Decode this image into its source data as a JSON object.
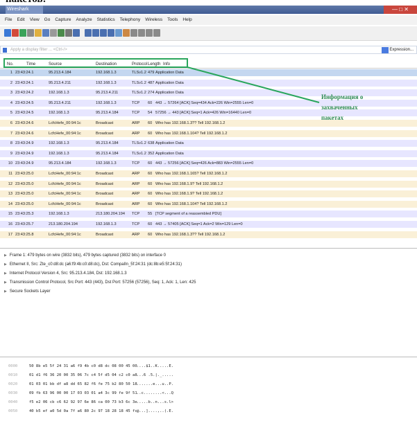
{
  "page": {
    "caption_fragment": "пакетов:"
  },
  "window": {
    "title": "Wireshark",
    "controls_label": "— □ ✕"
  },
  "menubar": [
    "File",
    "Edit",
    "View",
    "Go",
    "Capture",
    "Analyze",
    "Statistics",
    "Telephony",
    "Wireless",
    "Tools",
    "Help"
  ],
  "toolbar": {
    "icons": [
      "shark-fin-icon",
      "stop-icon",
      "restart-icon",
      "settings-icon",
      "open-file-icon",
      "save-icon",
      "close-file-icon",
      "reload-icon",
      "find-icon",
      "back-icon",
      "forward-icon",
      "go-to-icon",
      "first-icon",
      "last-icon",
      "autoscroll-icon",
      "colorize-icon",
      "zoom-in-icon",
      "zoom-out-icon",
      "zoom-reset-icon",
      "resize-columns-icon"
    ]
  },
  "filter": {
    "placeholder": "Apply a display filter ... <Ctrl-/>",
    "expression_label": "Expression..."
  },
  "columns": [
    "No.",
    "Time",
    "Source",
    "Destination",
    "Protocol",
    "Length",
    "Info"
  ],
  "packets": [
    {
      "no": "1",
      "time": "23:43:24.1",
      "src": "95.213.4.184",
      "dst": "192.168.1.3",
      "proto": "TLSv1.2",
      "len": "479",
      "info": "Application Data",
      "type": "sel"
    },
    {
      "no": "2",
      "time": "23:43:24.1",
      "src": "95.213.4.211",
      "dst": "192.168.1.3",
      "proto": "TLSv1.2",
      "len": "487",
      "info": "Application Data",
      "type": "tcp"
    },
    {
      "no": "3",
      "time": "23:43:24.2",
      "src": "192.168.1.3",
      "dst": "95.213.4.211",
      "proto": "TLSv1.2",
      "len": "274",
      "info": "Application Data",
      "type": "tcp"
    },
    {
      "no": "4",
      "time": "23:43:24.5",
      "src": "95.213.4.211",
      "dst": "192.168.1.3",
      "proto": "TCP",
      "len": "60",
      "info": "443 → 57264 [ACK] Seq=434 Ack=226 Win=2555 Len=0",
      "type": "tcp"
    },
    {
      "no": "5",
      "time": "23:43:24.5",
      "src": "192.168.1.3",
      "dst": "95.213.4.184",
      "proto": "TCP",
      "len": "54",
      "info": "57256 → 443 [ACK] Seq=1 Ack=426 Win=16440 Len=0",
      "type": "tcp"
    },
    {
      "no": "6",
      "time": "23:43:24.6",
      "src": "LcfcHefe_00:94:1c",
      "dst": "Broadcast",
      "proto": "ARP",
      "len": "60",
      "info": "Who has 192.168.1.3?? Tell 192.168.1.2",
      "type": "arp"
    },
    {
      "no": "7",
      "time": "23:43:24.6",
      "src": "LcfcHefe_00:94:1c",
      "dst": "Broadcast",
      "proto": "ARP",
      "len": "60",
      "info": "Who has 192.168.1.104? Tell 192.168.1.2",
      "type": "arp"
    },
    {
      "no": "8",
      "time": "23:43:24.9",
      "src": "192.168.1.3",
      "dst": "95.213.4.184",
      "proto": "TLSv1.2",
      "len": "638",
      "info": "Application Data",
      "type": "tcp"
    },
    {
      "no": "9",
      "time": "23:43:24.9",
      "src": "192.168.1.3",
      "dst": "95.213.4.184",
      "proto": "TLSv1.2",
      "len": "352",
      "info": "Application Data",
      "type": "tcp"
    },
    {
      "no": "10",
      "time": "23:43:24.9",
      "src": "95.213.4.184",
      "dst": "192.168.1.3",
      "proto": "TCP",
      "len": "60",
      "info": "443 → 57256 [ACK] Seq=426 Ack=883 Win=2555 Len=0",
      "type": "tcp"
    },
    {
      "no": "11",
      "time": "23:43:25.0",
      "src": "LcfcHefe_00:94:1c",
      "dst": "Broadcast",
      "proto": "ARP",
      "len": "60",
      "info": "Who has 192.168.1.165? Tell 192.168.1.2",
      "type": "arp"
    },
    {
      "no": "12",
      "time": "23:43:25.0",
      "src": "LcfcHefe_00:94:1c",
      "dst": "Broadcast",
      "proto": "ARP",
      "len": "60",
      "info": "Who has 192.168.1.9? Tell 192.168.1.2",
      "type": "arp"
    },
    {
      "no": "13",
      "time": "23:43:25.0",
      "src": "LcfcHefe_00:94:1c",
      "dst": "Broadcast",
      "proto": "ARP",
      "len": "60",
      "info": "Who has 192.168.1.9? Tell 192.168.1.2",
      "type": "arp"
    },
    {
      "no": "14",
      "time": "23:43:25.0",
      "src": "LcfcHefe_00:94:1c",
      "dst": "Broadcast",
      "proto": "ARP",
      "len": "60",
      "info": "Who has 192.168.1.104? Tell 192.168.1.2",
      "type": "arp"
    },
    {
      "no": "15",
      "time": "23:43:25.3",
      "src": "192.168.1.3",
      "dst": "213.180.204.194",
      "proto": "TCP",
      "len": "55",
      "info": "[TCP segment of a reassembled PDU]",
      "type": "tcp"
    },
    {
      "no": "16",
      "time": "23:43:25.7",
      "src": "213.180.204.194",
      "dst": "192.168.1.3",
      "proto": "TCP",
      "len": "60",
      "info": "443 → 57405 [ACK] Seq=1 Ack=2 Win=129 Len=0",
      "type": "tcp"
    },
    {
      "no": "17",
      "time": "23:43:25.8",
      "src": "LcfcHefe_00:94:1c",
      "dst": "Broadcast",
      "proto": "ARP",
      "len": "60",
      "info": "Who has 192.168.1.3?? Tell 192.168.1.2",
      "type": "arp"
    }
  ],
  "details": [
    "Frame 1: 479 bytes on wire (3832 bits), 479 bytes captured (3832 bits) on interface 0",
    "Ethernet II, Src: Zte_c0:d8:dc (a6:f9:4b:c0:d8:dc), Dst: CompalIn_5f:24:31 (dc:8b:e5:5f:24:31)",
    "Internet Protocol Version 4, Src: 95.213.4.184, Dst: 192.168.1.3",
    "Transmission Control Protocol, Src Port: 443 (443), Dst Port: 57256 (57256), Seq: 1, Ack: 1, Len: 425",
    "Secure Sockets Layer"
  ],
  "bytes": [
    {
      "off": "0000",
      "hex": "50 8b e5 5f 24 31 a6 f9  4b c0 d8 dc 08 00 45 00",
      "ascii": "....$1..K.....E."
    },
    {
      "off": "0010",
      "hex": "01 d1 f6 36 20 00 35 06  7c c4 5f d5 04 c2 c0 a8",
      "ascii": "...6 .5.|._....."
    },
    {
      "off": "0020",
      "hex": "01 03 01 bb df a8 dd 65  82 f6 fe 75 b2 80 50 18",
      "ascii": ".......e...u..P."
    },
    {
      "off": "0030",
      "hex": "09 fb 63 96 00 00 17 03  03 01 a4 3c 99 fe 9f 51",
      "ascii": "..c........<...Q"
    },
    {
      "off": "0040",
      "hex": "f5 e2 06 cb c6 62 92 97  6e 86 ca 00 73 b3 6c 3e",
      "ascii": ".....b..n...s.l>"
    },
    {
      "off": "0050",
      "hex": "40 b5 ef a0 5d 0a 7f a6  80 2c 97 18 28 18 45 fc",
      "ascii": "@...]....,..(.E."
    }
  ],
  "annotation": {
    "line1": "Информация о",
    "line2": "захваченных",
    "line3": "пакетах"
  },
  "colors": {
    "tcp_row": "#e7e6ff",
    "arp_row": "#faf0d7",
    "selected_row": "#c4d7f0",
    "annotation_green": "#2aa65c"
  }
}
